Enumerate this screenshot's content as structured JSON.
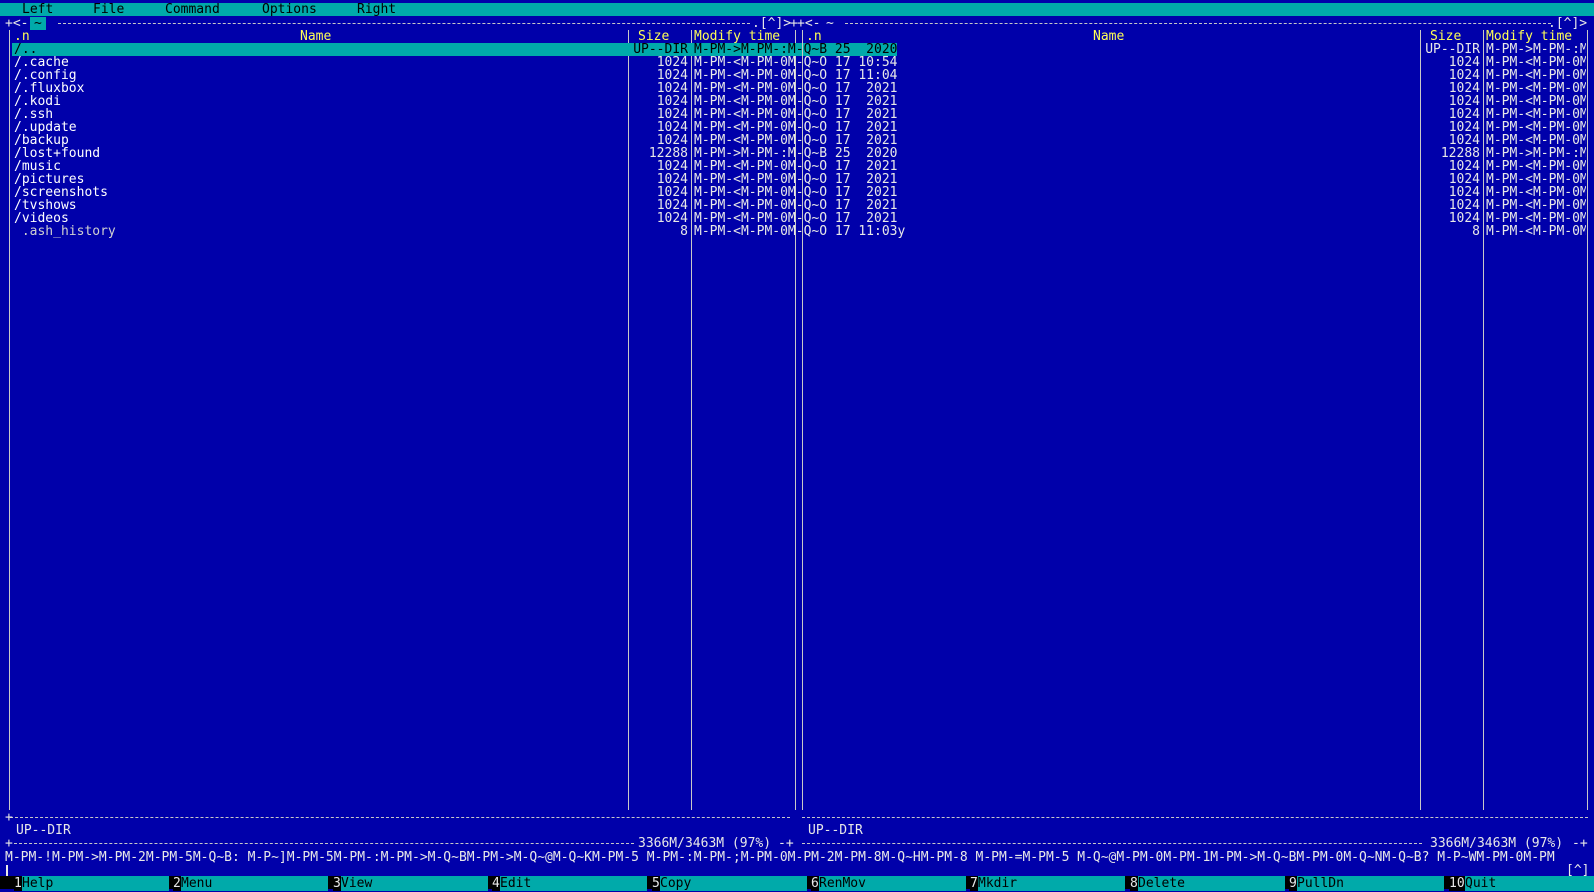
{
  "menubar": {
    "items": [
      "Left",
      "File",
      "Command",
      "Options",
      "Right"
    ]
  },
  "left_panel": {
    "path": "~",
    "top_right": ".[^]>",
    "headers": {
      "n": ".n",
      "name": "Name",
      "size": "Size",
      "mtime": "Modify time"
    },
    "rows": [
      {
        "name": "/..",
        "size": "UP--DIR",
        "mtime": "M-PM->M-PM-:M-Q~B 25  2020",
        "selected": true
      },
      {
        "name": "/.cache",
        "size": "1024",
        "mtime": "M-PM-<M-PM-0M-Q~O 17 10:54"
      },
      {
        "name": "/.config",
        "size": "1024",
        "mtime": "M-PM-<M-PM-0M-Q~O 17 11:04"
      },
      {
        "name": "/.fluxbox",
        "size": "1024",
        "mtime": "M-PM-<M-PM-0M-Q~O 17  2021"
      },
      {
        "name": "/.kodi",
        "size": "1024",
        "mtime": "M-PM-<M-PM-0M-Q~O 17  2021"
      },
      {
        "name": "/.ssh",
        "size": "1024",
        "mtime": "M-PM-<M-PM-0M-Q~O 17  2021"
      },
      {
        "name": "/.update",
        "size": "1024",
        "mtime": "M-PM-<M-PM-0M-Q~O 17  2021"
      },
      {
        "name": "/backup",
        "size": "1024",
        "mtime": "M-PM-<M-PM-0M-Q~O 17  2021"
      },
      {
        "name": "/lost+found",
        "size": "12288",
        "mtime": "M-PM->M-PM-:M-Q~B 25  2020"
      },
      {
        "name": "/music",
        "size": "1024",
        "mtime": "M-PM-<M-PM-0M-Q~O 17  2021"
      },
      {
        "name": "/pictures",
        "size": "1024",
        "mtime": "M-PM-<M-PM-0M-Q~O 17  2021"
      },
      {
        "name": "/screenshots",
        "size": "1024",
        "mtime": "M-PM-<M-PM-0M-Q~O 17  2021"
      },
      {
        "name": "/tvshows",
        "size": "1024",
        "mtime": "M-PM-<M-PM-0M-Q~O 17  2021"
      },
      {
        "name": "/videos",
        "size": "1024",
        "mtime": "M-PM-<M-PM-0M-Q~O 17  2021"
      },
      {
        "name": " .ash_history",
        "size": "8",
        "mtime": "M-PM-<M-PM-0M-Q~O 17 11:03y",
        "file": true
      }
    ],
    "status": "UP--DIR",
    "disk": "3366M/3463M (97%)"
  },
  "right_panel": {
    "path": "~",
    "top_right": ".[^]>",
    "headers": {
      "n": ".n",
      "name": "Name",
      "size": "Size",
      "mtime": "Modify time"
    },
    "rows": [
      {
        "name": "",
        "size": "UP--DIR",
        "mtime": "M-PM->M-PM-:M"
      },
      {
        "name": "",
        "size": "1024",
        "mtime": "M-PM-<M-PM-0M"
      },
      {
        "name": "",
        "size": "1024",
        "mtime": "M-PM-<M-PM-0M"
      },
      {
        "name": "",
        "size": "1024",
        "mtime": "M-PM-<M-PM-0M"
      },
      {
        "name": "",
        "size": "1024",
        "mtime": "M-PM-<M-PM-0M"
      },
      {
        "name": "",
        "size": "1024",
        "mtime": "M-PM-<M-PM-0M"
      },
      {
        "name": "",
        "size": "1024",
        "mtime": "M-PM-<M-PM-0M"
      },
      {
        "name": "",
        "size": "1024",
        "mtime": "M-PM-<M-PM-0M"
      },
      {
        "name": "",
        "size": "12288",
        "mtime": "M-PM->M-PM-:M"
      },
      {
        "name": "",
        "size": "1024",
        "mtime": "M-PM-<M-PM-0M"
      },
      {
        "name": "",
        "size": "1024",
        "mtime": "M-PM-<M-PM-0M"
      },
      {
        "name": "",
        "size": "1024",
        "mtime": "M-PM-<M-PM-0M"
      },
      {
        "name": "",
        "size": "1024",
        "mtime": "M-PM-<M-PM-0M"
      },
      {
        "name": "",
        "size": "1024",
        "mtime": "M-PM-<M-PM-0M"
      },
      {
        "name": "",
        "size": "8",
        "mtime": "M-PM-<M-PM-0M",
        "file": true
      }
    ],
    "status": "UP--DIR",
    "disk": "3366M/3463M (97%)"
  },
  "hint": "M-PM-!M-PM->M-PM-2M-PM-5M-Q~B: M-P~]M-PM-5M-PM-:M-PM->M-Q~BM-PM->M-Q~@M-Q~KM-PM-5 M-PM-:M-PM-;M-PM-0M-PM-2M-PM-8M-Q~HM-PM-8 M-PM-=M-PM-5 M-Q~@M-PM-0M-PM-1M-PM->M-Q~BM-PM-0M-Q~NM-Q~B? M-P~WM-PM-0M-PM",
  "cmdline_indicator": "[^]",
  "fkeys": [
    {
      "num": "1",
      "label": "Help"
    },
    {
      "num": "2",
      "label": "Menu"
    },
    {
      "num": "3",
      "label": "View"
    },
    {
      "num": "4",
      "label": "Edit"
    },
    {
      "num": "5",
      "label": "Copy"
    },
    {
      "num": "6",
      "label": "RenMov"
    },
    {
      "num": "7",
      "label": "Mkdir"
    },
    {
      "num": "8",
      "label": "Delete"
    },
    {
      "num": "9",
      "label": "PullDn"
    },
    {
      "num": "10",
      "label": "Quit"
    }
  ]
}
